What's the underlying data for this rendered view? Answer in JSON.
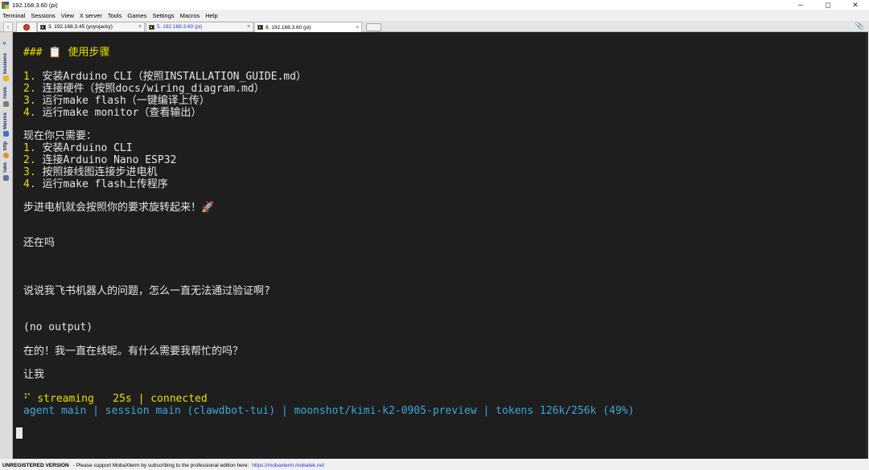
{
  "window": {
    "title": "192.168.3.60 (pi)",
    "controls": {
      "minimize": "─",
      "maximize": "◻",
      "close": "✕"
    }
  },
  "menu": [
    "Terminal",
    "Sessions",
    "View",
    "X server",
    "Tools",
    "Games",
    "Settings",
    "Macros",
    "Help"
  ],
  "tabs": [
    {
      "label": "3. 192.168.3.45 (yoyojacky)",
      "active": false
    },
    {
      "label": "5. 192.168.3.60 (pi)",
      "active": false
    },
    {
      "label": "8. 192.168.3.60 (pi)",
      "active": true
    }
  ],
  "tab_close": "×",
  "sidebar": {
    "collapse": "«",
    "items": [
      "Sessions",
      "Tools",
      "Macros",
      "Sftp",
      "Tabs"
    ]
  },
  "terminal": {
    "heading": "### 📋 使用步骤",
    "steps1": [
      {
        "n": "1.",
        "text": " 安装Arduino CLI（按照INSTALLATION_GUIDE.md）"
      },
      {
        "n": "2.",
        "text": " 连接硬件（按照docs/wiring_diagram.md）"
      },
      {
        "n": "3.",
        "text": " 运行make flash（一键编译上传）"
      },
      {
        "n": "4.",
        "text": " 运行make monitor（查看输出）"
      }
    ],
    "need_title": "现在你只需要：",
    "steps2": [
      {
        "n": "1.",
        "text": " 安装Arduino CLI"
      },
      {
        "n": "2.",
        "text": " 连接Arduino Nano ESP32"
      },
      {
        "n": "3.",
        "text": " 按照接线图连接步进电机"
      },
      {
        "n": "4.",
        "text": " 运行make flash上传程序"
      }
    ],
    "result": "步进电机就会按照你的要求旋转起来！🚀",
    "msg_still": "还在吗",
    "msg_question": "说说我飞书机器人的问题，怎么一直无法通过验证啊?",
    "no_output": "(no output)",
    "reply": "在的！我一直在线呢。有什么需要我帮忙的吗？",
    "msg_let": "让我",
    "status_streaming": "⠋ streaming   25s | connected",
    "status_info": "agent main | session main (clawdbot-tui) | moonshot/kimi-k2-0905-preview | tokens 126k/256k (49%)"
  },
  "statusbar": {
    "unregistered": "UNREGISTERED VERSION",
    "message": "-  Please support MobaXterm by subscribing to the professional edition here:",
    "link": "https://mobaxterm.mobatek.net"
  },
  "colors": {
    "terminal_bg": "#1e1e1e",
    "number": "#e8e000",
    "status_cyan": "#3aa8d8"
  }
}
